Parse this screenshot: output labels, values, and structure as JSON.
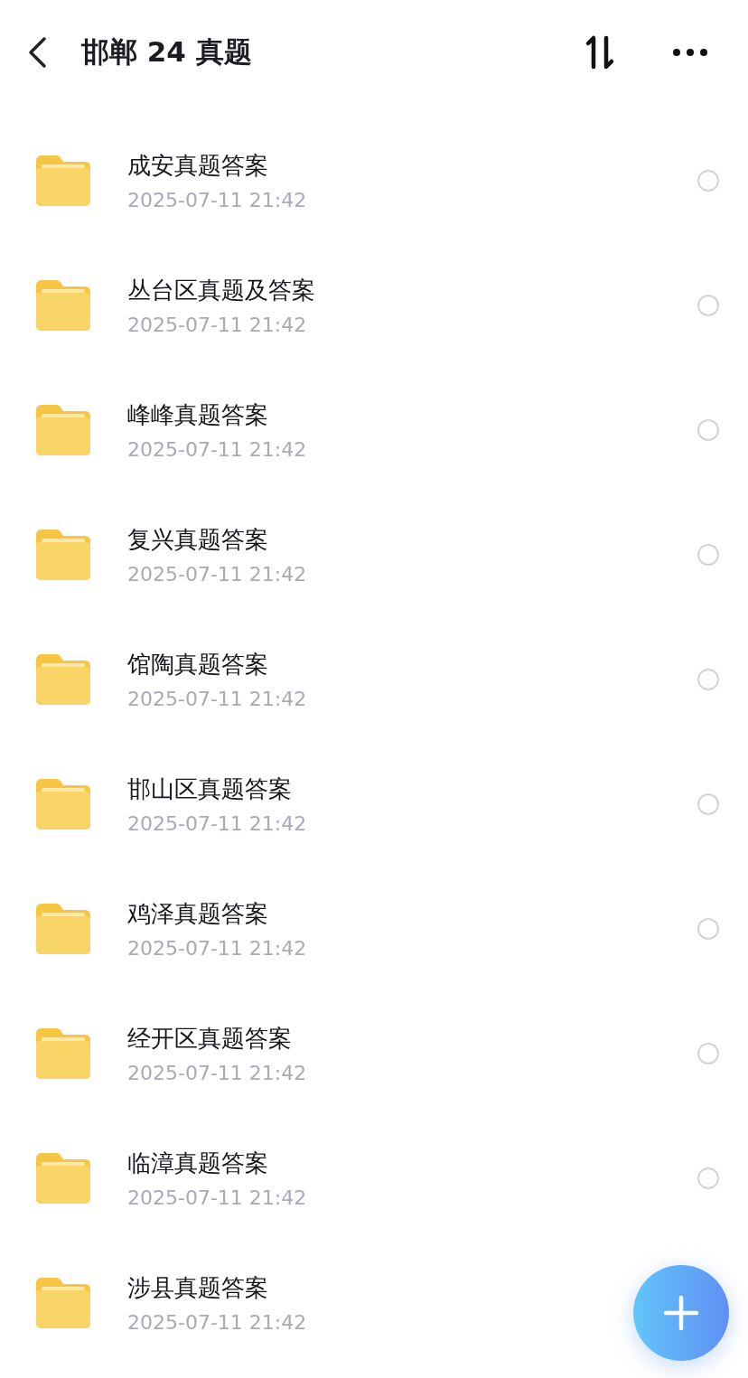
{
  "header": {
    "title": "邯郸 24 真题"
  },
  "files": [
    {
      "name": "成安真题答案",
      "date": "2025-07-11 21:42",
      "selected": false
    },
    {
      "name": "丛台区真题及答案",
      "date": "2025-07-11 21:42",
      "selected": false
    },
    {
      "name": "峰峰真题答案",
      "date": "2025-07-11 21:42",
      "selected": false
    },
    {
      "name": "复兴真题答案",
      "date": "2025-07-11 21:42",
      "selected": false
    },
    {
      "name": "馆陶真题答案",
      "date": "2025-07-11 21:42",
      "selected": false
    },
    {
      "name": "邯山区真题答案",
      "date": "2025-07-11 21:42",
      "selected": false
    },
    {
      "name": "鸡泽真题答案",
      "date": "2025-07-11 21:42",
      "selected": false
    },
    {
      "name": "经开区真题答案",
      "date": "2025-07-11 21:42",
      "selected": false
    },
    {
      "name": "临漳真题答案",
      "date": "2025-07-11 21:42",
      "selected": false
    },
    {
      "name": "涉县真题答案",
      "date": "2025-07-11 21:42"
    }
  ]
}
